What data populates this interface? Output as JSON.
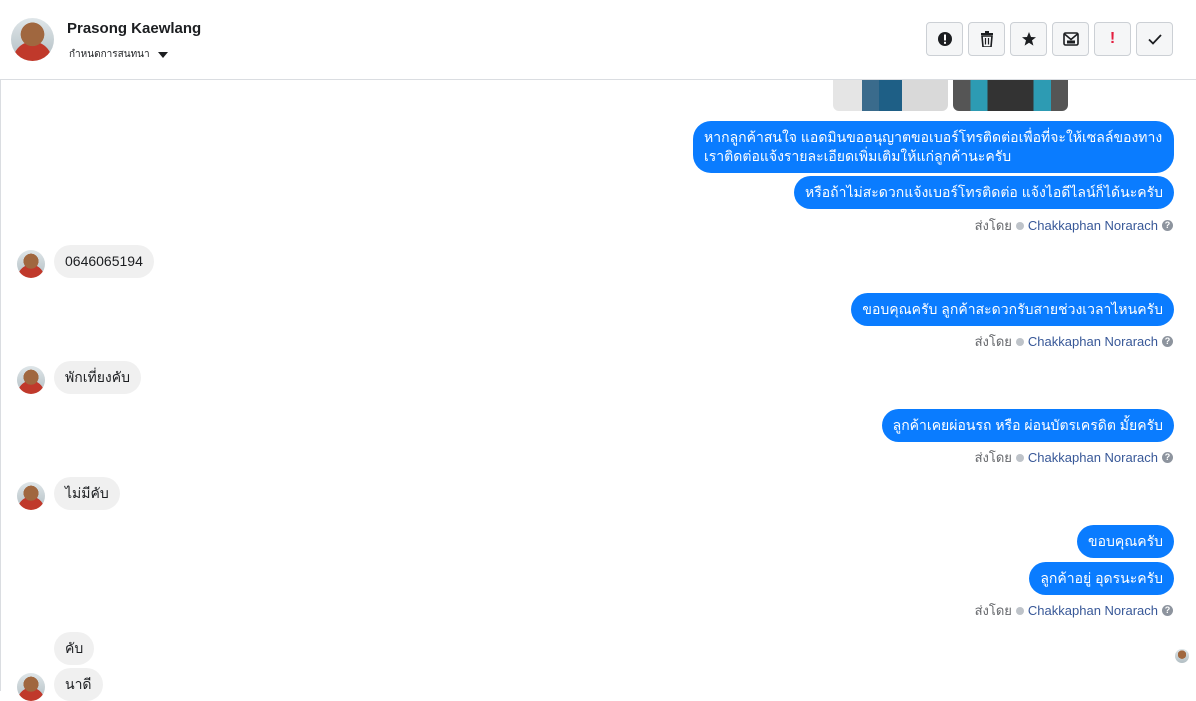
{
  "header": {
    "contact_name": "Prasong Kaewlang",
    "status_label": "กำหนดการสนทนา",
    "toolbar": [
      {
        "icon": "alert-circle-icon",
        "glyph": "!"
      },
      {
        "icon": "trash-icon",
        "glyph": "🗑"
      },
      {
        "icon": "star-icon",
        "glyph": "★"
      },
      {
        "icon": "mark-unread-icon",
        "glyph": "✉"
      },
      {
        "icon": "important-icon",
        "glyph": "!"
      },
      {
        "icon": "done-check-icon",
        "glyph": "✓"
      }
    ]
  },
  "conversation": {
    "agent_prefix": "ส่งโดย",
    "agent_name": "Chakkaphan Norarach",
    "info_glyph": "?",
    "messages": [
      {
        "from": "page",
        "text": "หากลูกค้าสนใจ แอดมินขออนุญาตขอเบอร์โทรติดต่อเพื่อที่จะให้เซลล์ของทางเราติดต่อแจ้งรายละเอียดเพิ่มเติมให้แก่ลูกค้านะครับ"
      },
      {
        "from": "page",
        "text": "หรือถ้าไม่สะดวกแจ้งเบอร์โทรติดต่อ แจ้งไอดีไลน์ก็ได้นะครับ"
      },
      {
        "from": "customer",
        "text": "0646065194"
      },
      {
        "from": "page",
        "text": "ขอบคุณครับ ลูกค้าสะดวกรับสายช่วงเวลาไหนครับ"
      },
      {
        "from": "customer",
        "text": "พักเที่ยงคับ"
      },
      {
        "from": "page",
        "text": "ลูกค้าเคยผ่อนรถ หรือ ผ่อนบัตรเครดิต มั้ยครับ"
      },
      {
        "from": "customer",
        "text": "ไม่มีคับ"
      },
      {
        "from": "page",
        "text": "ขอบคุณครับ"
      },
      {
        "from": "page",
        "text": "ลูกค้าอยู่ อุดรนะครับ"
      },
      {
        "from": "customer",
        "text": "คับ"
      },
      {
        "from": "customer",
        "text": "นาดี"
      }
    ]
  }
}
